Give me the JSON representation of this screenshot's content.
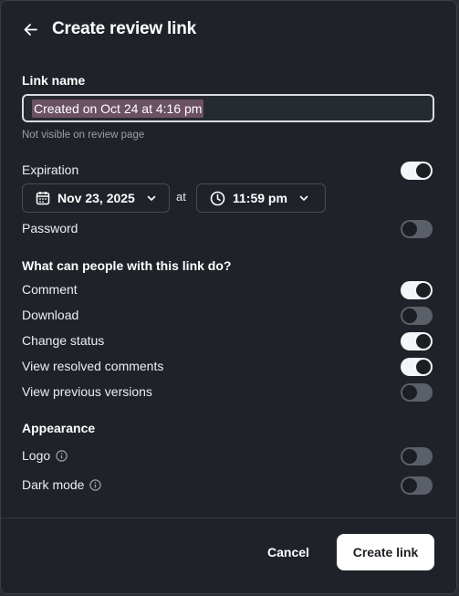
{
  "header": {
    "title": "Create review link",
    "back_icon": "arrow-left-icon"
  },
  "link_name": {
    "label": "Link name",
    "value": "Created on Oct 24 at 4:16 pm",
    "hint": "Not visible on review page"
  },
  "expiration": {
    "label": "Expiration",
    "enabled": true,
    "date": "Nov 23, 2025",
    "at": "at",
    "time": "11:59 pm"
  },
  "password": {
    "label": "Password",
    "enabled": false
  },
  "permissions": {
    "heading": "What can people with this link do?",
    "items": [
      {
        "label": "Comment",
        "enabled": true
      },
      {
        "label": "Download",
        "enabled": false
      },
      {
        "label": "Change status",
        "enabled": true
      },
      {
        "label": "View resolved comments",
        "enabled": true
      },
      {
        "label": "View previous versions",
        "enabled": false
      }
    ]
  },
  "appearance": {
    "heading": "Appearance",
    "items": [
      {
        "label": "Logo",
        "enabled": false,
        "info_icon": "info-icon"
      },
      {
        "label": "Dark mode",
        "enabled": false,
        "info_icon": "info-icon"
      }
    ]
  },
  "footer": {
    "cancel_label": "Cancel",
    "create_label": "Create link"
  },
  "colors": {
    "panel_bg": "#1f2329",
    "toggle_on": "#f4f5f7",
    "toggle_off": "#5a5f68",
    "selection": "#6b5263"
  }
}
